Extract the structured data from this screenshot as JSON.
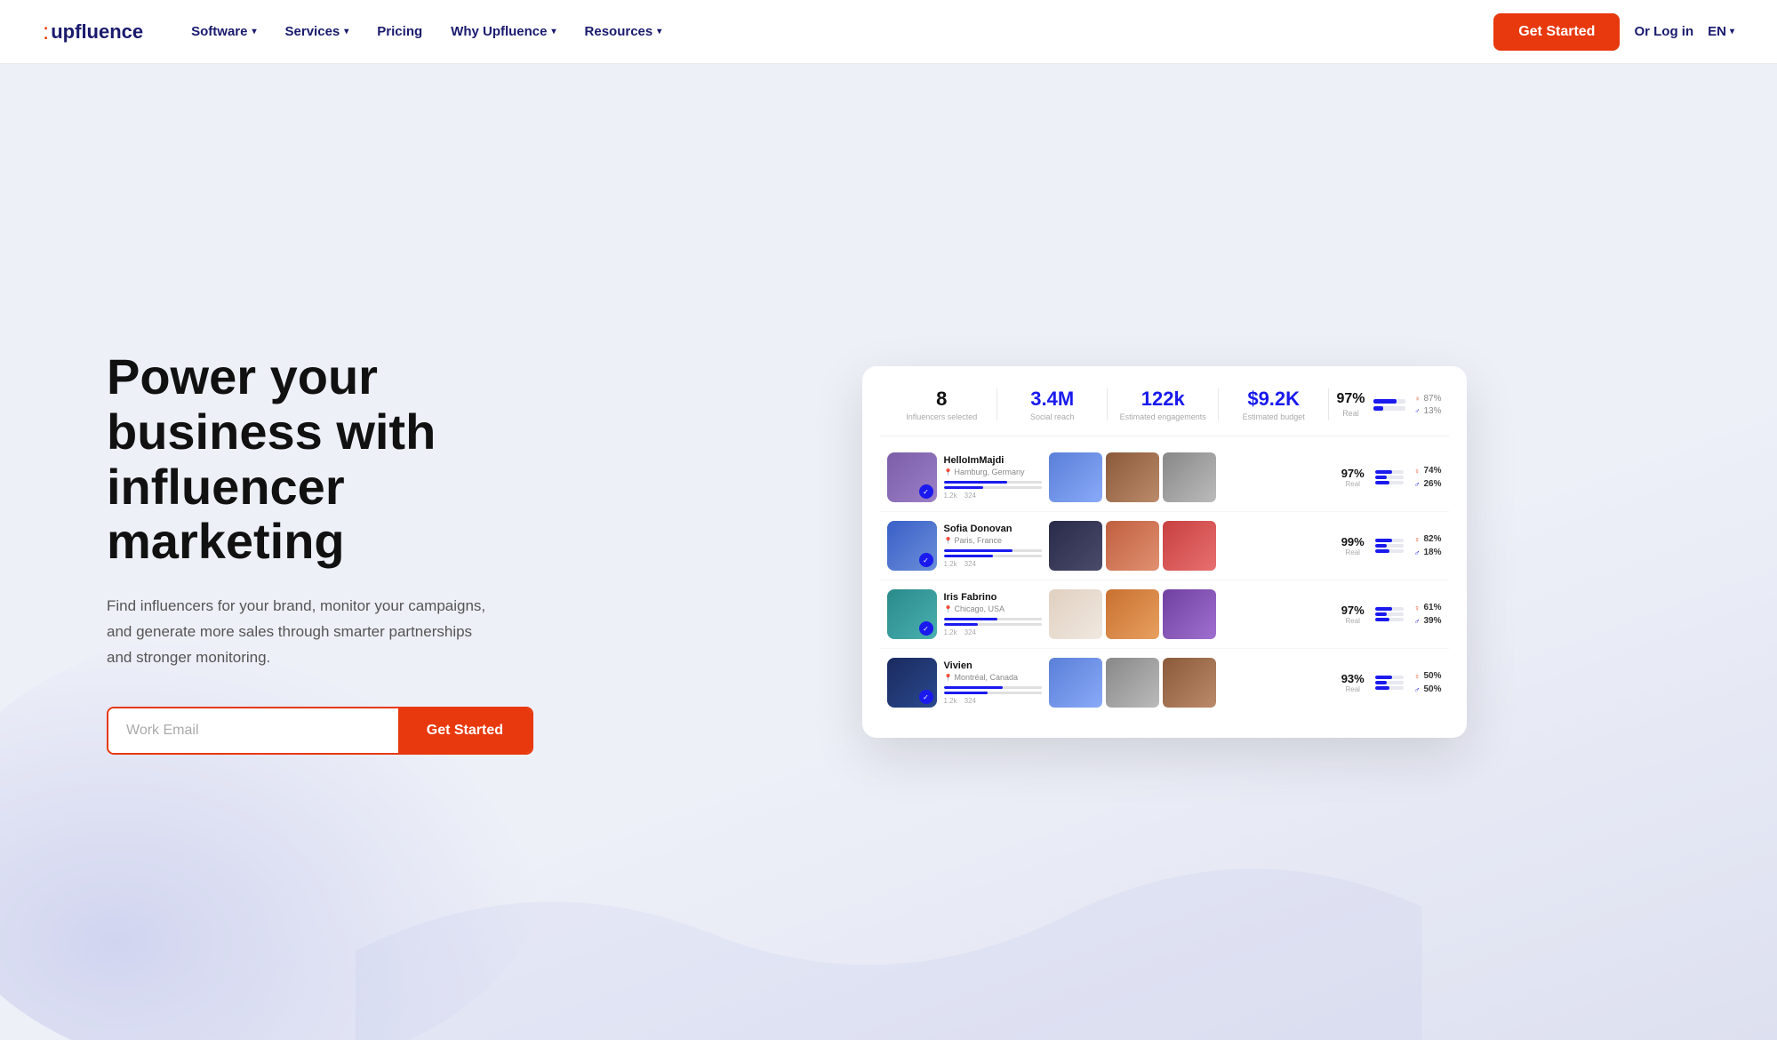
{
  "brand": {
    "logo_dot": ":",
    "logo_text": "upfluence"
  },
  "nav": {
    "software_label": "Software",
    "services_label": "Services",
    "pricing_label": "Pricing",
    "why_label": "Why Upfluence",
    "resources_label": "Resources",
    "get_started_label": "Get Started",
    "login_label": "Or Log in",
    "lang_label": "EN"
  },
  "hero": {
    "title": "Power your business with influencer marketing",
    "subtitle": "Find influencers for your brand, monitor your campaigns, and generate more sales through smarter partnerships and stronger monitoring.",
    "email_placeholder": "Work Email",
    "cta_label": "Get Started"
  },
  "dashboard": {
    "stats": {
      "influencers": "8",
      "influencers_label": "Influencers selected",
      "reach": "3.4M",
      "reach_label": "Social reach",
      "engagements": "122k",
      "engagements_label": "Estimated engagements",
      "budget": "$9.2K",
      "budget_label": "Estimated budget",
      "real_pct": "97%",
      "real_label": "Real",
      "female_pct": "87%",
      "male_pct": "13%"
    },
    "influencers": [
      {
        "name": "HelloImMajdi",
        "location": "Hamburg, Germany",
        "real_pct": "97%",
        "female_pct": "74%",
        "male_pct": "26%",
        "avatar_bg": "bg-purple",
        "photos": [
          "photo-blue",
          "photo-brown",
          "photo-gray"
        ],
        "bar1": 65,
        "bar2": 40
      },
      {
        "name": "Sofia Donovan",
        "location": "Paris, France",
        "real_pct": "99%",
        "female_pct": "82%",
        "male_pct": "18%",
        "avatar_bg": "bg-blue",
        "photos": [
          "photo-dark",
          "photo-warm",
          "photo-red"
        ],
        "bar1": 70,
        "bar2": 50
      },
      {
        "name": "Iris Fabrino",
        "location": "Chicago, USA",
        "real_pct": "97%",
        "female_pct": "61%",
        "male_pct": "39%",
        "avatar_bg": "bg-teal",
        "photos": [
          "photo-light",
          "photo-orange",
          "photo-purple"
        ],
        "bar1": 55,
        "bar2": 35
      },
      {
        "name": "Vivien",
        "location": "Montréal, Canada",
        "real_pct": "93%",
        "female_pct": "50%",
        "male_pct": "50%",
        "avatar_bg": "bg-navy",
        "photos": [
          "photo-blue",
          "photo-gray",
          "photo-brown"
        ],
        "bar1": 60,
        "bar2": 45
      }
    ]
  }
}
